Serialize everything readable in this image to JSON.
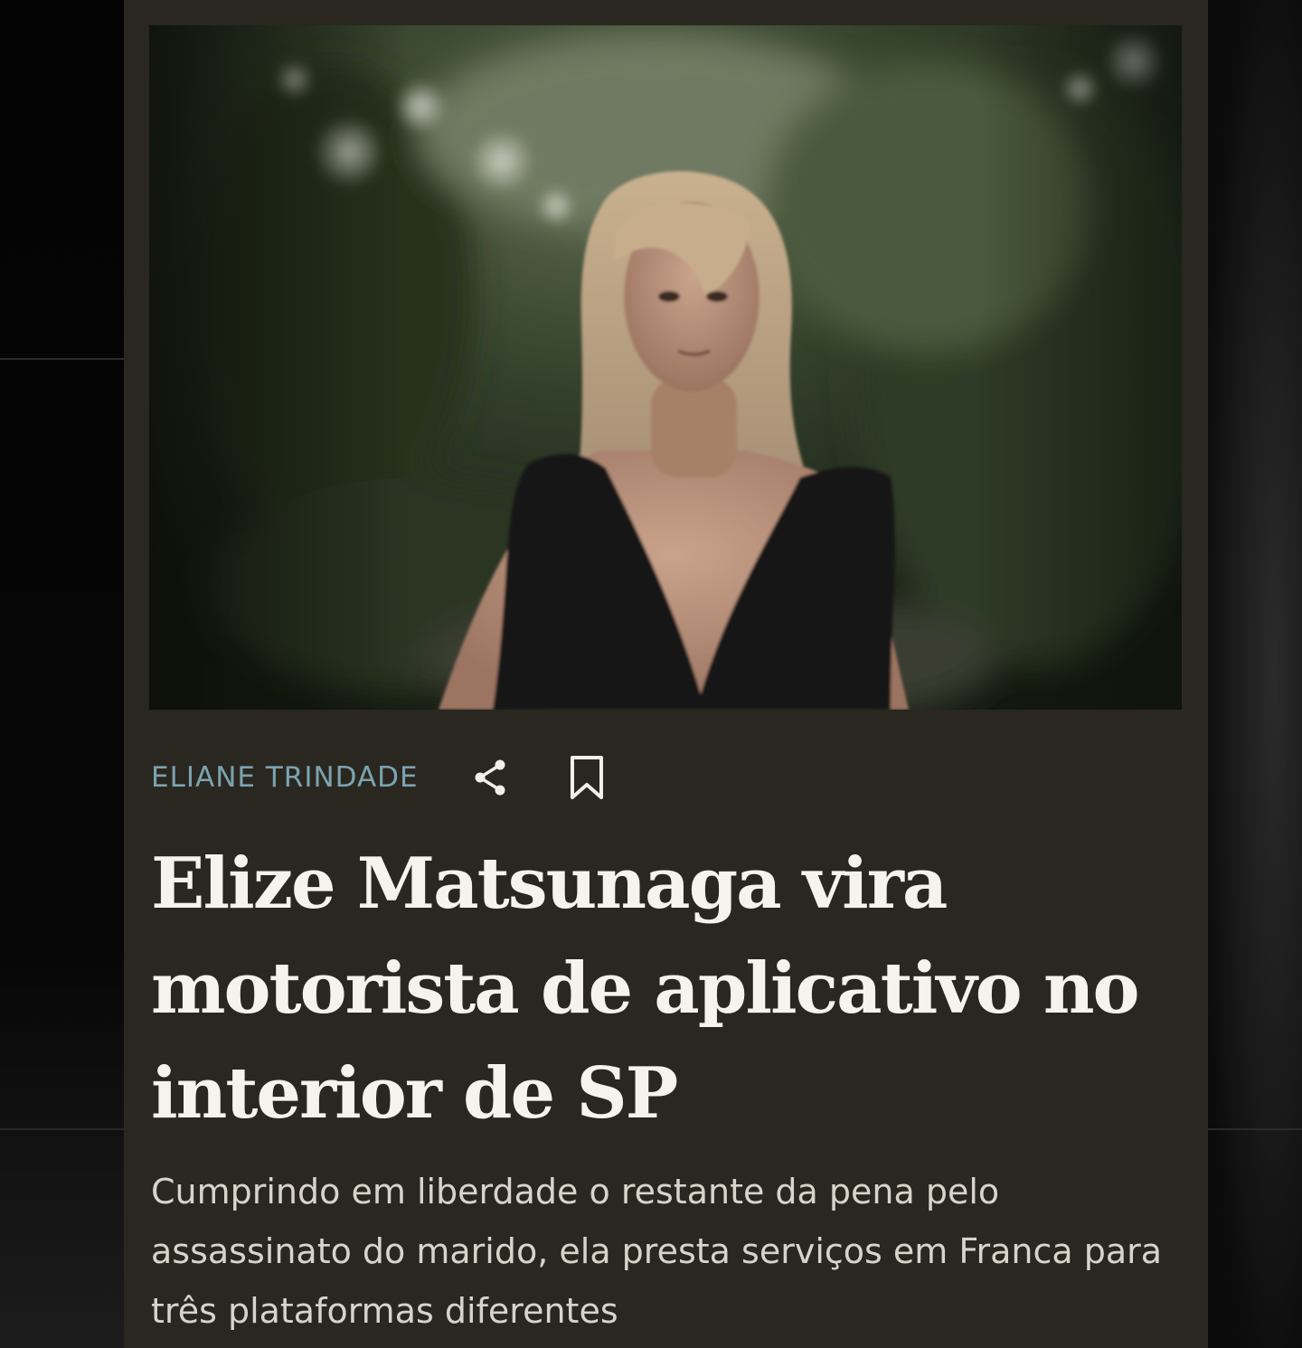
{
  "article": {
    "author": "ELIANE TRINDADE",
    "headline": "Elize Matsunaga vira motorista de aplicativo no interior de SP",
    "summary": "Cumprindo em liberdade o restante da pena pelo assassinato do marido, ela presta serviços em Franca para três plataformas diferentes",
    "actions": {
      "share_icon": "share-icon",
      "bookmark_icon": "bookmark-icon"
    }
  },
  "colors": {
    "card_background": "#2a2720",
    "author": "#7ba3b0",
    "headline": "#f6f3ec",
    "summary": "#d8d4cb"
  }
}
